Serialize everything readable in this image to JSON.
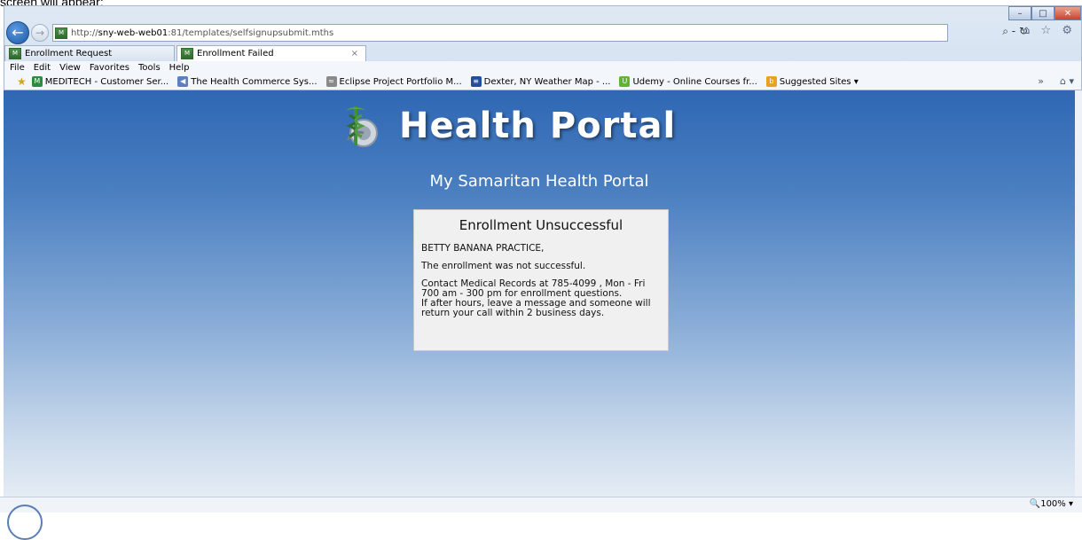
{
  "doc_caption": "screen will appear:",
  "browser": {
    "url_prefix": "http://",
    "url_host": "sny-web-web01",
    "url_rest": ":81/templates/selfsignupsubmit.mths",
    "search_glyph": "⌕ - ↻",
    "toolbar_icons": "⌂ ☆ ⚙",
    "tabs": [
      {
        "label": "Enrollment Request"
      },
      {
        "label": "Enrollment Failed",
        "close": "×"
      }
    ],
    "menu": [
      "File",
      "Edit",
      "View",
      "Favorites",
      "Tools",
      "Help"
    ],
    "favorites": [
      {
        "label": "MEDITECH - Customer Ser...",
        "icon": "M",
        "color": "#2d8a3e"
      },
      {
        "label": "The Health Commerce Sys...",
        "icon": "◀",
        "color": "#5b7fbf"
      },
      {
        "label": "Eclipse Project Portfolio M...",
        "icon": "≈",
        "color": "#8a8a8a"
      },
      {
        "label": "Dexter, NY Weather Map - ...",
        "icon": "≡",
        "color": "#1f4f9e"
      },
      {
        "label": "Udemy - Online Courses fr...",
        "icon": "U",
        "color": "#5fb532"
      },
      {
        "label": "Suggested Sites ▾",
        "icon": "b",
        "color": "#e8a21b"
      }
    ],
    "fav_right_chevron": "»",
    "fav_right_home": "⌂ ▾",
    "zoom": "🔍100%  ▾"
  },
  "page": {
    "logo_title": "Health Portal",
    "subtitle": "My Samaritan Health Portal",
    "card": {
      "title": "Enrollment Unsuccessful",
      "greeting": "BETTY BANANA PRACTICE,",
      "message": "The enrollment was not successful.",
      "contact_1": "Contact Medical Records at 785-4099 , Mon - Fri 700 am - 300 pm for enrollment questions.",
      "contact_2": "If after hours, leave a message and someone will return your call within 2 business days."
    }
  }
}
